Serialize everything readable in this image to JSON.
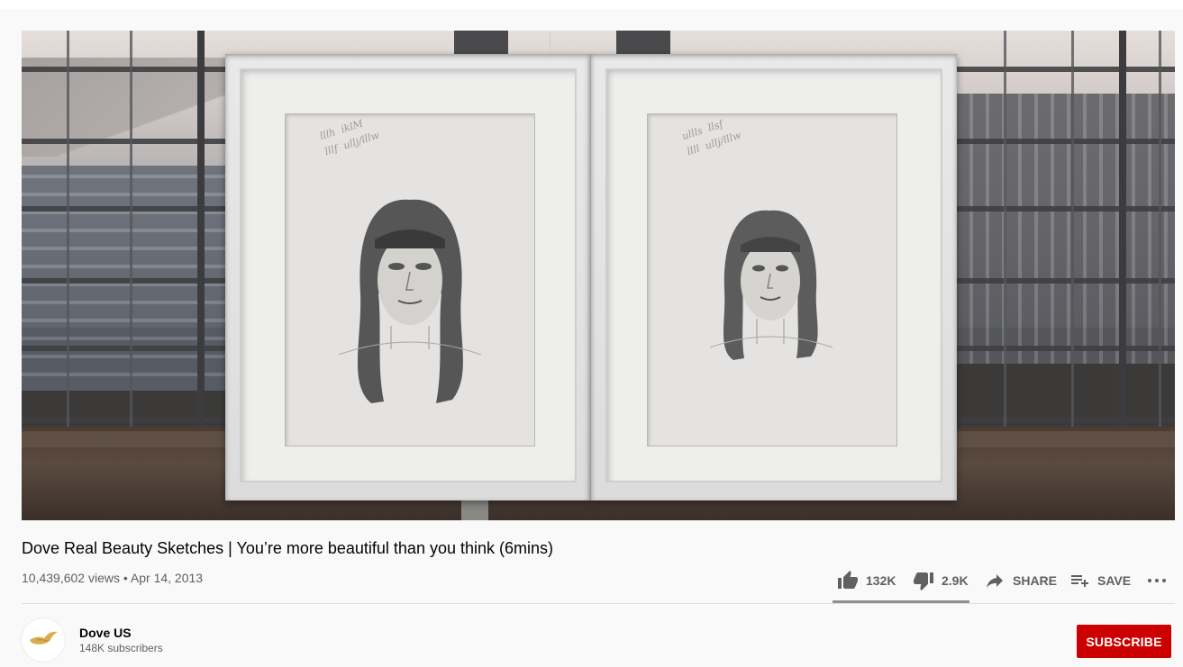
{
  "video": {
    "title": "Dove Real Beauty Sketches | You’re more beautiful than you think (6mins)",
    "views": "10,439,602 views",
    "separator": "•",
    "date": "Apr 14, 2013"
  },
  "actions": {
    "like_count": "132K",
    "dislike_count": "2.9K",
    "share_label": "SHARE",
    "save_label": "SAVE",
    "like_ratio": 0.978
  },
  "channel": {
    "name": "Dove US",
    "subscribers": "148K subscribers",
    "subscribe_label": "SUBSCRIBE"
  },
  "icons": {
    "like": "thumb-up-icon",
    "dislike": "thumb-down-icon",
    "share": "share-arrow-icon",
    "save": "playlist-add-icon",
    "more": "more-horizontal-icon",
    "avatar": "dove-bird-logo"
  },
  "colors": {
    "subscribe": "#cc0000",
    "secondary_text": "#606060",
    "page_bg": "#f9f9f9"
  }
}
